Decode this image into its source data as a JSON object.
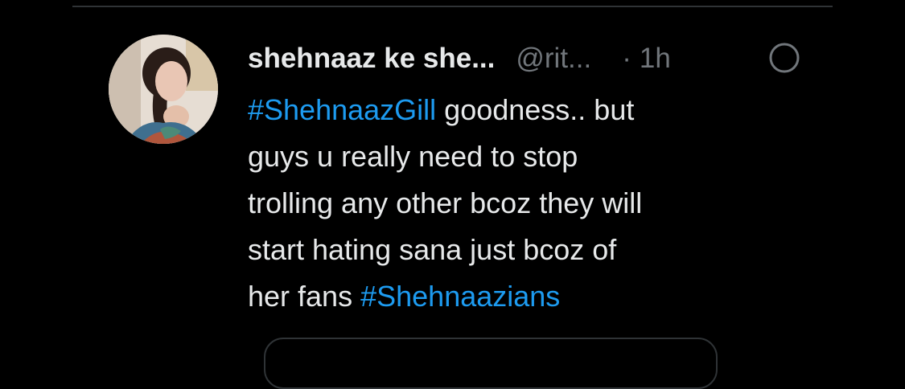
{
  "tweet": {
    "author": {
      "display_name": "shehnaaz ke she...",
      "handle": "@rit...",
      "avatar_icon": "profile-photo"
    },
    "separator": "·",
    "time": "1h",
    "more_icon": "circle-outline-icon",
    "text": {
      "hashtag_1": "#ShehnaazGill",
      "line_1_rest": " goodness.. but",
      "line_2": "guys u really need to stop",
      "line_3": "trolling any other bcoz they will",
      "line_4": "start hating sana just bcoz of",
      "line_5_start": "her fans ",
      "hashtag_2": "#Shehnaazians"
    }
  },
  "colors": {
    "background": "#000000",
    "text": "#e7e9ea",
    "secondary": "#71767b",
    "hashtag": "#1d9bf0",
    "divider": "#2f3336"
  }
}
